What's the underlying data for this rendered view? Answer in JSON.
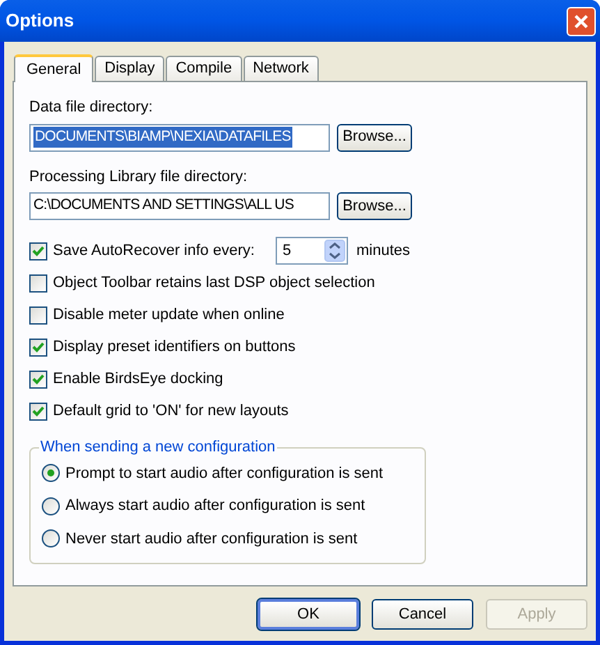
{
  "window": {
    "title": "Options"
  },
  "tabs": [
    {
      "label": "General",
      "selected": true
    },
    {
      "label": "Display",
      "selected": false
    },
    {
      "label": "Compile",
      "selected": false
    },
    {
      "label": "Network",
      "selected": false
    }
  ],
  "directories": [
    {
      "label": "Data file directory:",
      "value": "DOCUMENTS\\BIAMP\\NEXIA\\DATAFILES",
      "selected": true,
      "button": "Browse..."
    },
    {
      "label": "Processing Library file directory:",
      "value": "C:\\DOCUMENTS AND SETTINGS\\ALL US",
      "selected": false,
      "button": "Browse..."
    }
  ],
  "options": [
    {
      "kind": "spin",
      "label": "Save AutoRecover info every:",
      "checked": true,
      "value": "5",
      "unit": "minutes"
    },
    {
      "kind": "check",
      "label": "Object Toolbar retains last DSP object selection",
      "checked": false
    },
    {
      "kind": "check",
      "label": "Disable meter update when online",
      "checked": false
    },
    {
      "kind": "check",
      "label": "Display preset identifiers on buttons",
      "checked": true
    },
    {
      "kind": "check",
      "label": "Enable BirdsEye docking",
      "checked": true
    },
    {
      "kind": "check",
      "label": "Default grid to 'ON' for new layouts",
      "checked": true
    }
  ],
  "send_config": {
    "legend": "When sending a new configuration",
    "choices": [
      {
        "label": "Prompt to start audio after configuration is sent",
        "selected": true
      },
      {
        "label": "Always start audio after configuration is sent",
        "selected": false
      },
      {
        "label": "Never start audio after configuration is sent",
        "selected": false
      }
    ]
  },
  "buttons": [
    {
      "label": "OK",
      "default": true,
      "disabled": false
    },
    {
      "label": "Cancel",
      "default": false,
      "disabled": false
    },
    {
      "label": "Apply",
      "default": false,
      "disabled": true
    }
  ]
}
